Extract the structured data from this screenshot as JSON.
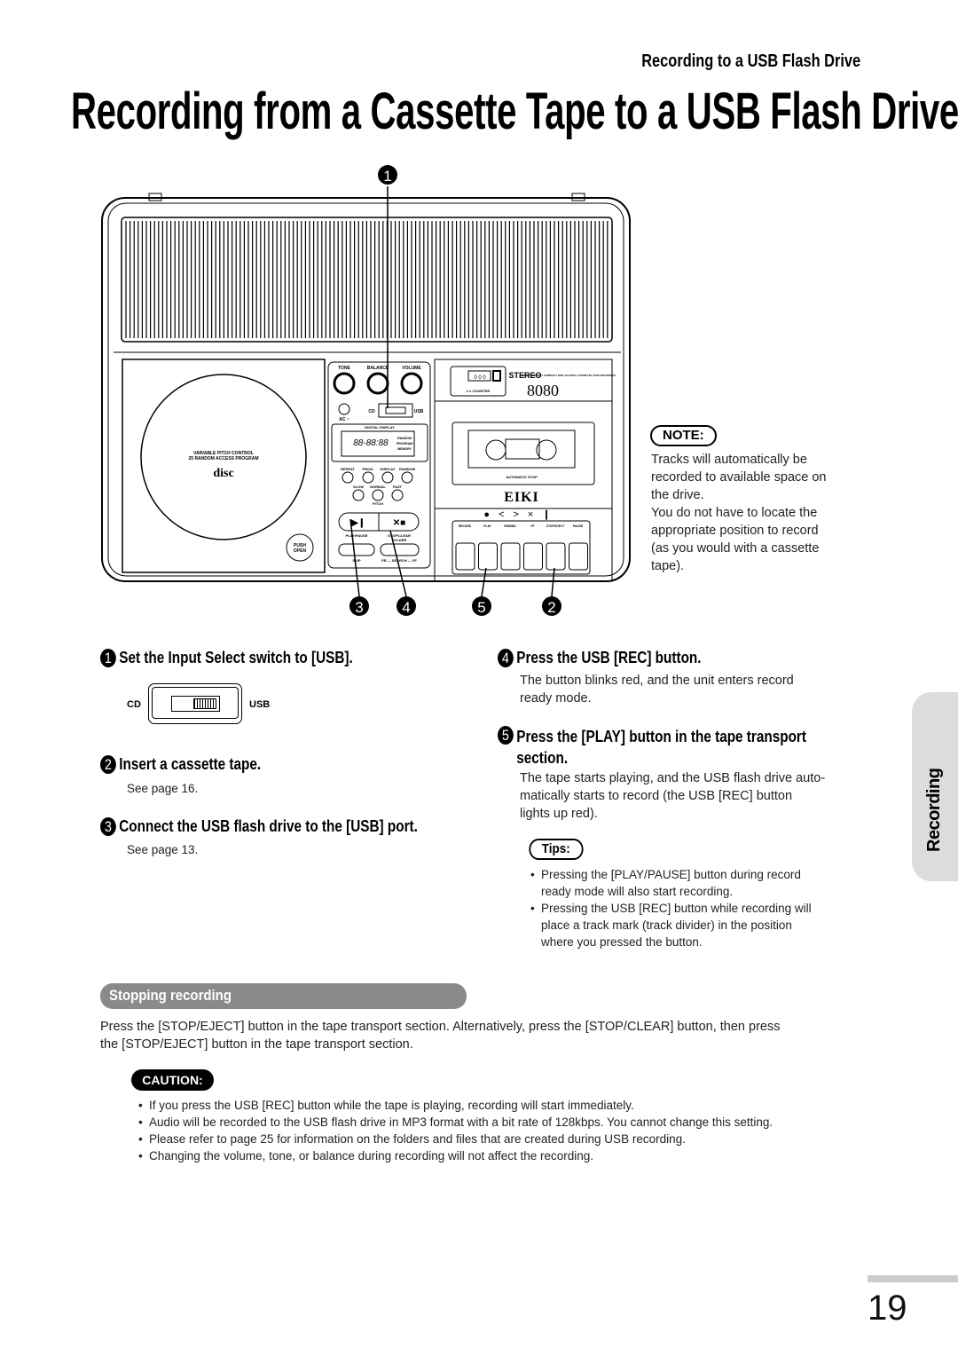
{
  "header": {
    "section": "Recording to a USB Flash Drive",
    "title": "Recording from a Cassette Tape to a USB Flash Drive"
  },
  "device": {
    "callouts": [
      "1",
      "3",
      "4",
      "5",
      "2"
    ],
    "cd_text1": "VARIABLE PITCH CONTROL",
    "cd_text2": "25 RANDOM ACCESS PROGRAM",
    "cd_logo": "disc",
    "push": "PUSH",
    "open": "OPEN",
    "knobs": [
      "TONE",
      "BALANCE",
      "VOLUME"
    ],
    "switch_left": "CD",
    "switch_right": "USB",
    "ac": "AC ~",
    "display_label": "DIGITAL DISPLAY",
    "display_digits": "88-88:88",
    "display_flags": [
      "RANDOM",
      "PROGRAM",
      "MEMORY"
    ],
    "buttons_row1": [
      "REPEAT",
      "PROG.",
      "DISPLAY",
      "RANDOM"
    ],
    "buttons_row2": [
      "SLOW",
      "NORMAL",
      "FAST"
    ],
    "pitch": "PITCH",
    "play_pause": "PLAY/PAUSE",
    "stop_clear": "STOP/CLEAR",
    "folder": "FOLDER",
    "skip": "SKIP",
    "search": "FR — SEARCH — FF",
    "counter": "0 0 0",
    "counter_label": "2 x COUNTER",
    "stereo": "STEREO",
    "model_desc": "USB RECORDER / COMPACT DISC PLAYER / CASSETTE TAPE RECORDER",
    "model": "8080",
    "automatic_stop": "AUTOMATIC STOP",
    "brand": "EIKI",
    "transport_keys": [
      "RECORD",
      "PLAY",
      "REWIND",
      "FF",
      "STOP/EJECT",
      "PAUSE"
    ]
  },
  "note": {
    "label": "NOTE:",
    "lines": [
      "Tracks will automatically be",
      "recorded to available space on",
      "the drive.",
      "You do not have to locate the",
      "appropriate position to record",
      "(as you would with a cassette",
      "tape)."
    ]
  },
  "steps": [
    {
      "num": "1",
      "title": "Set the Input Select switch to [USB].",
      "switch_left": "CD",
      "switch_right": "USB"
    },
    {
      "num": "2",
      "title": "Insert a cassette tape.",
      "desc": "See page 16."
    },
    {
      "num": "3",
      "title": "Connect the USB flash drive to the [USB] port.",
      "desc": "See page 13."
    },
    {
      "num": "4",
      "title": "Press the USB [REC] button.",
      "desc": [
        "The button blinks red, and the unit enters record",
        "ready mode."
      ]
    },
    {
      "num": "5",
      "title": [
        "Press the [PLAY] button in the tape transport",
        "section."
      ],
      "desc": [
        "The tape starts playing, and the USB flash drive auto-",
        "matically starts to record (the USB [REC] button",
        "lights up red)."
      ]
    }
  ],
  "tips": {
    "label": "Tips:",
    "items": [
      [
        "Pressing the [PLAY/PAUSE] button during record",
        "ready mode will also start recording."
      ],
      [
        "Pressing the USB [REC] button while recording will",
        "place a track mark (track divider) in the position",
        "where you pressed the button."
      ]
    ]
  },
  "stopping": {
    "heading": "Stopping recording",
    "text": [
      "Press the [STOP/EJECT] button in the tape transport section. Alternatively, press the [STOP/CLEAR] button, then press",
      "the [STOP/EJECT] button in the tape transport section."
    ]
  },
  "caution": {
    "label": "CAUTION:",
    "items": [
      "If you press the USB [REC] button while the tape is playing, recording will start immediately.",
      "Audio will be recorded to the USB flash drive in MP3 format with a bit rate of 128kbps. You cannot change this setting.",
      "Please refer to page 25 for information on the folders and files that are created during USB recording.",
      "Changing the volume, tone, or balance during recording will not affect the recording."
    ]
  },
  "side_tab": "Recording",
  "page_number": "19"
}
